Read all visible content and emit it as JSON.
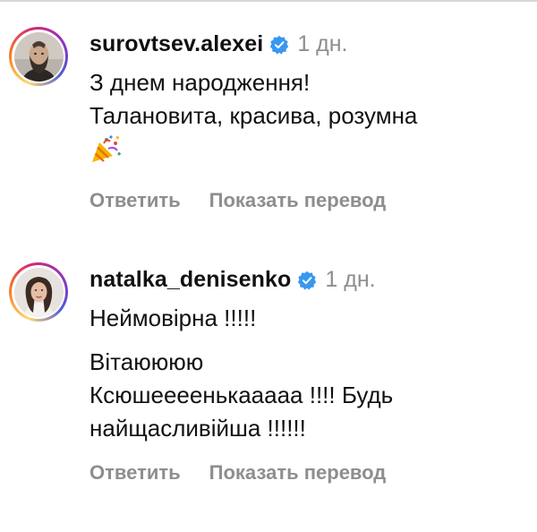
{
  "comments": [
    {
      "username": "surovtsev.alexei",
      "avatar_icon": "avatar-bearded-man",
      "verified_icon": "verified-badge-icon",
      "time": "1 дн.",
      "lines": [
        "З днем народження!",
        "Талановита, красива, розумна"
      ],
      "emoji_icon": "party-popper-emoji",
      "reply_label": "Ответить",
      "translate_label": "Показать перевод"
    },
    {
      "username": "natalka_denisenko",
      "avatar_icon": "avatar-woman",
      "verified_icon": "verified-badge-icon",
      "time": "1 дн.",
      "lines": [
        "Неймовірна !!!!!",
        "Вітаюююю",
        "Ксюшеееенькааааа !!!! Будь",
        "найщасливійша !!!!!!"
      ],
      "reply_label": "Ответить",
      "translate_label": "Показать перевод"
    }
  ],
  "colors": {
    "text": "#111111",
    "muted": "#8e8e8e",
    "verified": "#3897f0"
  }
}
